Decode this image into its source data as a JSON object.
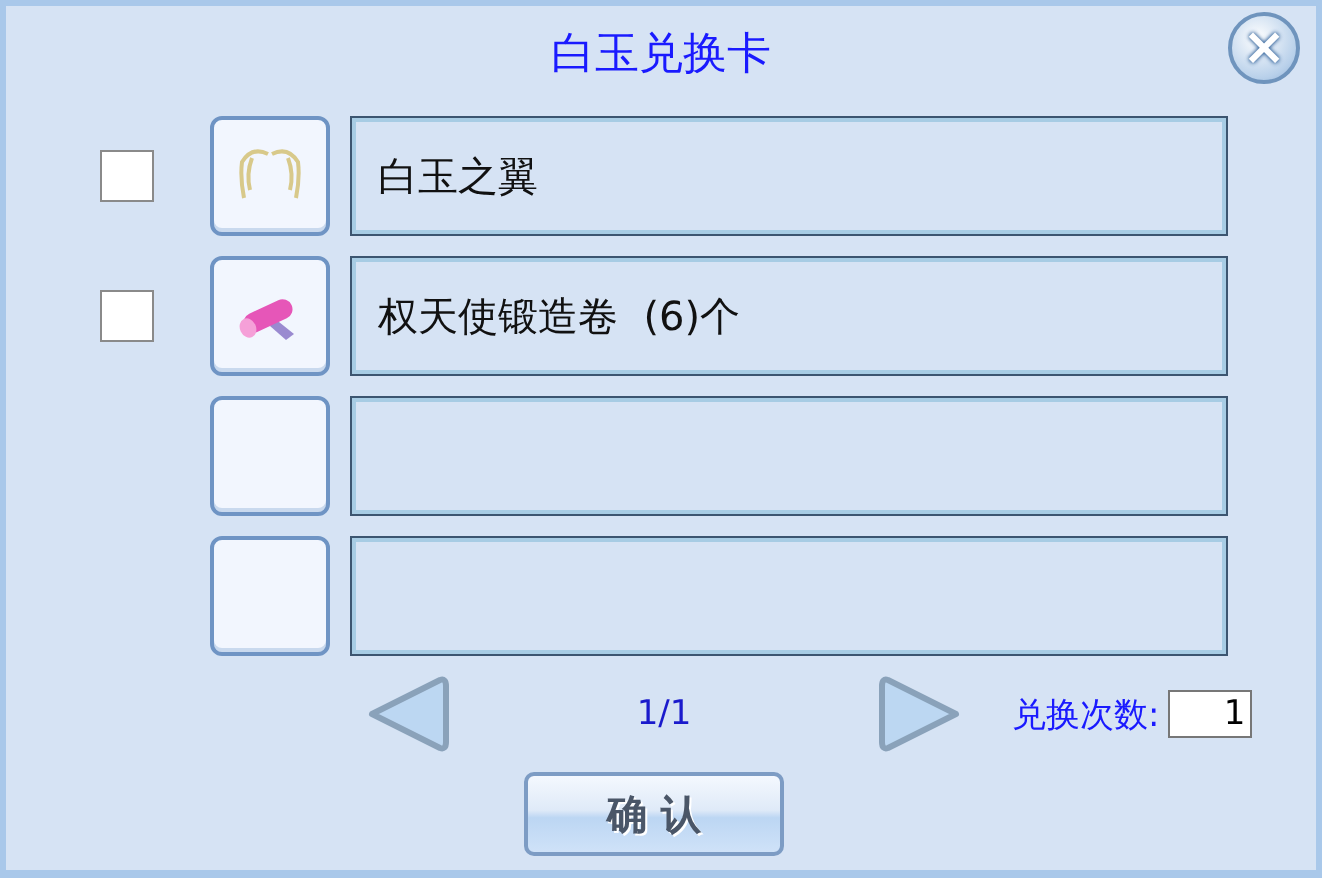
{
  "window": {
    "title": "白玉兑换卡",
    "close": "×"
  },
  "rows": [
    {
      "kind": "wings",
      "checked": false,
      "name": "白玉之翼"
    },
    {
      "kind": "scroll",
      "checked": false,
      "name": "权天使锻造卷  (6)个"
    },
    {
      "kind": "empty"
    },
    {
      "kind": "empty"
    }
  ],
  "pager": {
    "page": "1/1"
  },
  "exchange_count": {
    "label": "兑换次数:",
    "value": "1"
  },
  "confirm": "确 认"
}
